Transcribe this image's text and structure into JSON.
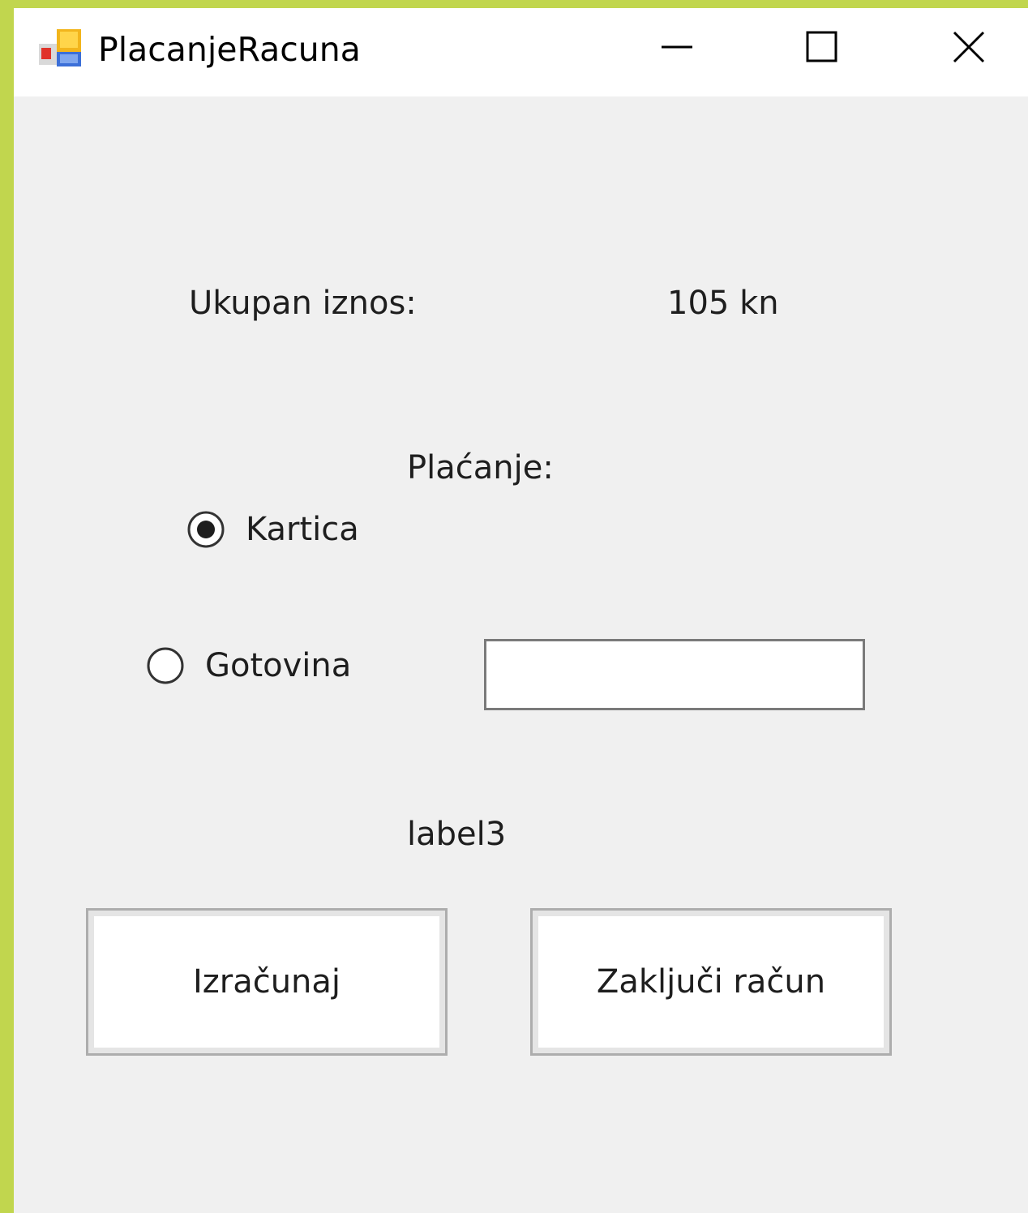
{
  "window": {
    "title": "PlacanjeRacuna",
    "buttons": {
      "minimize": "minimize-icon",
      "maximize": "maximize-icon",
      "close": "close-icon"
    }
  },
  "form": {
    "total_label": "Ukupan iznos:",
    "total_value": "105 kn",
    "payment_label": "Plaćanje:",
    "payment_options": [
      {
        "label": "Kartica",
        "checked": true
      },
      {
        "label": "Gotovina",
        "checked": false
      }
    ],
    "cash_input": {
      "value": "",
      "placeholder": ""
    },
    "status_label": "label3",
    "calculate_button": "Izračunaj",
    "close_bill_button": "Zaključi račun"
  },
  "colors": {
    "desktop_background": "#c1d64e",
    "window_background": "#f0f0f0",
    "titlebar_background": "#ffffff",
    "text": "#1e1e1e"
  }
}
